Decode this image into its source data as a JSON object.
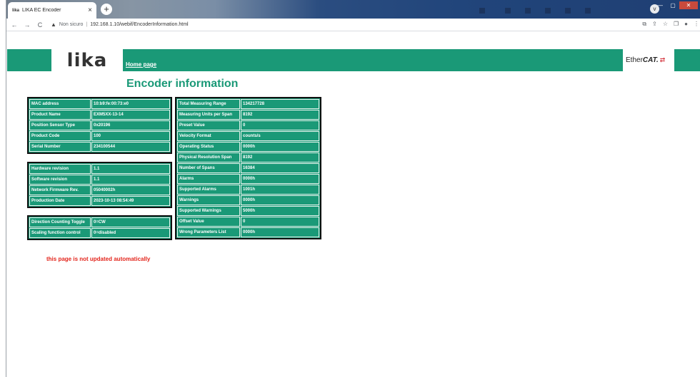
{
  "browser": {
    "tab_favicon": "lika",
    "tab_title": "LIKA EC Encoder",
    "tab_close": "×",
    "new_tab": "+",
    "back": "←",
    "forward": "→",
    "reload": "C",
    "security_icon": "▲",
    "security_label": "Non sicuro",
    "url": "192.168.1.10/webif/EncoderInformation.html",
    "minimize": "—",
    "maximize": "▢",
    "close": "✕",
    "profile": "v",
    "toolbar_icons": [
      "⧉",
      "⇪",
      "☆",
      "❐",
      "●",
      "⋮"
    ]
  },
  "header": {
    "logo_text": "lika",
    "home_link": "Home page",
    "ethercat_pre": "Ether",
    "ethercat_bold": "CAT.",
    "ethercat_arrow": "⇄"
  },
  "title": "Encoder information",
  "tables": {
    "identity": [
      [
        "MAC address",
        "10:b9:fe:00:73:e0"
      ],
      [
        "Product Name",
        "EXM5XX-13-14"
      ],
      [
        "Position Sensor Type",
        "0x20196"
      ],
      [
        "Product Code",
        "100"
      ],
      [
        "Serial Number",
        "234100544"
      ]
    ],
    "revisions": [
      [
        "Hardware revision",
        "1.1"
      ],
      [
        "Software revision",
        "1.1"
      ],
      [
        "Network Firmware Rev.",
        "05040002h"
      ],
      [
        "Production Date",
        "2023-10-13 08:54:49"
      ]
    ],
    "config": [
      [
        "Direction Counting Toggle",
        "0=CW"
      ],
      [
        "Scaling function control",
        "0=disabled"
      ]
    ],
    "measures": [
      [
        "Total Measuring Range",
        "134217728"
      ],
      [
        "Measuring Units per Span",
        "8192"
      ],
      [
        "Preset Value",
        "0"
      ],
      [
        "Velocity Format",
        "counts/s"
      ],
      [
        "Operating Status",
        "0000h"
      ],
      [
        "Physical Resolution Span",
        "8192"
      ],
      [
        "Number of Spans",
        "16384"
      ],
      [
        "Alarms",
        "0000h"
      ],
      [
        "Supported Alarms",
        "1001h"
      ],
      [
        "Warnings",
        "0000h"
      ],
      [
        "Supported Warnings",
        "5000h"
      ],
      [
        "Offset Value",
        "0"
      ],
      [
        "Wrong Parameters List",
        "0000h"
      ]
    ]
  },
  "note": "this page is not updated automatically"
}
